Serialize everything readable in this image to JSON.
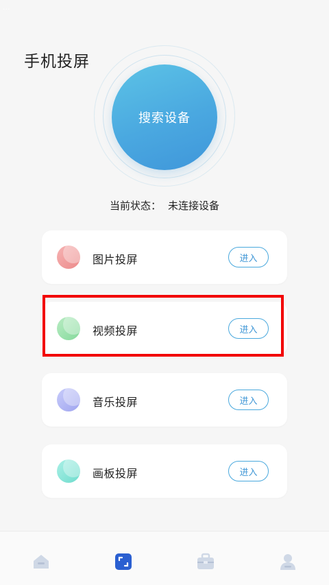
{
  "statusbar": {
    "signal_text": "..."
  },
  "header": {
    "title": "手机投屏"
  },
  "search": {
    "button_label": "搜索设备"
  },
  "status": {
    "label": "当前状态：",
    "value": "未连接设备"
  },
  "cards": [
    {
      "label": "图片投屏",
      "button": "进入",
      "color": "#ec8a8a"
    },
    {
      "label": "视频投屏",
      "button": "进入",
      "color": "#84d99b"
    },
    {
      "label": "音乐投屏",
      "button": "进入",
      "color": "#9fa4ef"
    },
    {
      "label": "画板投屏",
      "button": "进入",
      "color": "#6fdccd"
    }
  ],
  "bottom_nav": {
    "items": [
      {
        "icon": "home-icon",
        "active": false
      },
      {
        "icon": "screen-cast-icon",
        "active": true
      },
      {
        "icon": "toolbox-icon",
        "active": false
      },
      {
        "icon": "person-icon",
        "active": false
      }
    ]
  },
  "colors": {
    "accent": "#4aa8e0",
    "highlight": "#f20000",
    "nav_inactive": "#c9d3e3",
    "nav_active": "#2a5fd1"
  }
}
